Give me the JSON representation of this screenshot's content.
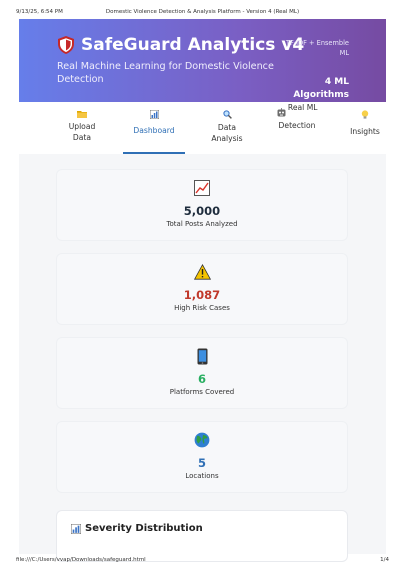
{
  "print_header": {
    "datetime": "9/13/25, 6:54 PM",
    "page_title": "Domestic Violence Detection & Analysis Platform - Version 4 (Real ML)"
  },
  "banner": {
    "title": "SafeGuard Analytics v4",
    "subtitle": "Real Machine Learning for Domestic Violence Detection",
    "method": "TF-IDF + Ensemble ML",
    "algorithms": "4 ML Algorithms",
    "brand_color": "#667eea",
    "brand_color_end": "#764ba2"
  },
  "tabs": [
    {
      "icon": "folder-icon",
      "label": "Upload Data"
    },
    {
      "icon": "bar-chart-icon",
      "label": "Dashboard",
      "active": true
    },
    {
      "icon": "magnifier-icon",
      "label": "Data Analysis"
    },
    {
      "icon": "robot-icon",
      "label": "Real ML Detection"
    },
    {
      "icon": "lightbulb-icon",
      "label": "Insights"
    }
  ],
  "stats": [
    {
      "icon": "chart-trend-icon",
      "value": "5,000",
      "label": "Total Posts Analyzed",
      "color": "#1f2d3d"
    },
    {
      "icon": "warning-icon",
      "value": "1,087",
      "label": "High Risk Cases",
      "color": "#c0392b"
    },
    {
      "icon": "phone-icon",
      "value": "6",
      "label": "Platforms Covered",
      "color": "#27ae60"
    },
    {
      "icon": "globe-icon",
      "value": "5",
      "label": "Locations",
      "color": "#2f6fb5"
    }
  ],
  "severity_section": {
    "title": "Severity Distribution",
    "icon": "bar-chart-icon"
  },
  "print_footer": {
    "url": "file:///C:/Users/vvap/Downloads/safeguard.html",
    "page": "1/4"
  }
}
